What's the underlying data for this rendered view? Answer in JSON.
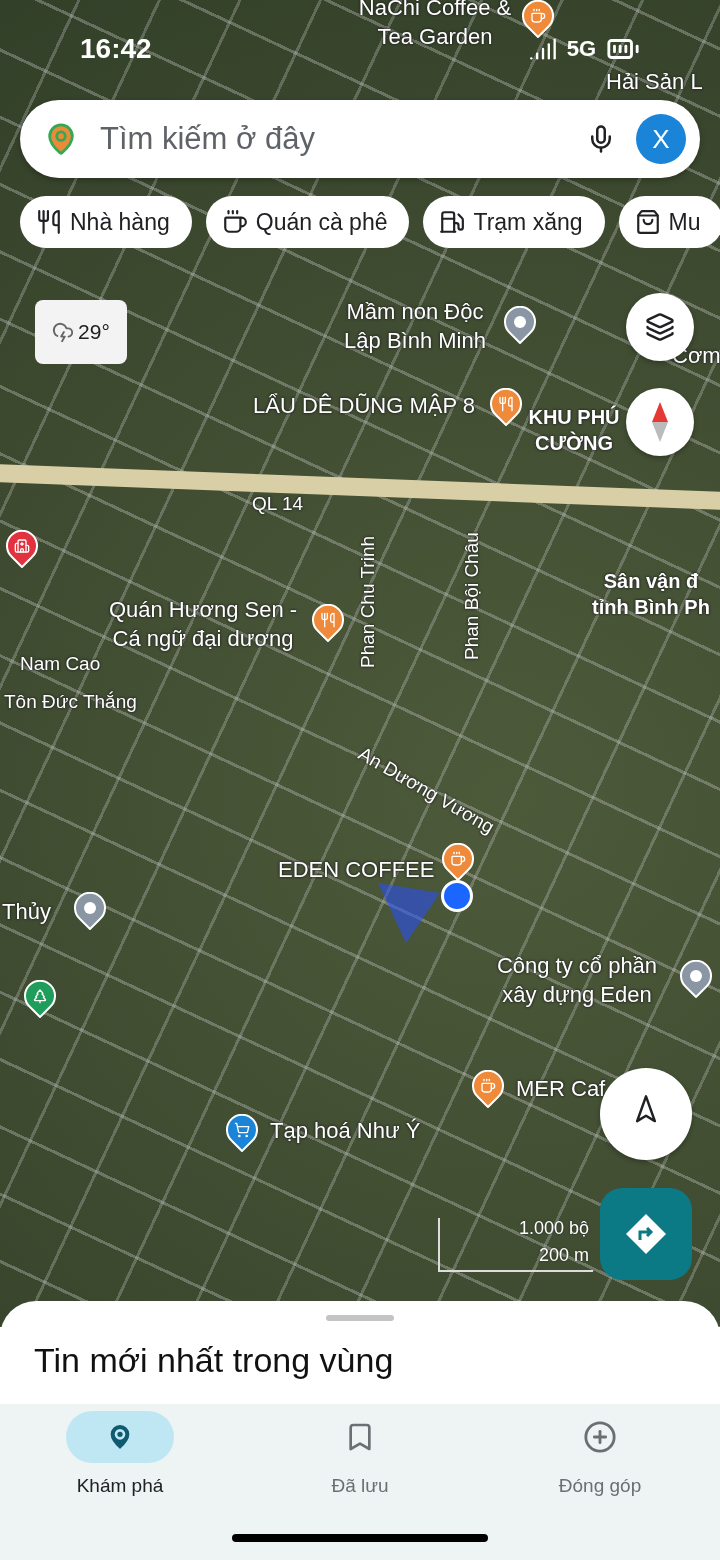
{
  "status_bar": {
    "time": "16:42",
    "network": "5G"
  },
  "search": {
    "placeholder": "Tìm kiếm ở đây",
    "avatar": "X"
  },
  "chips": [
    {
      "label": "Nhà hàng",
      "kind": "food"
    },
    {
      "label": "Quán cà phê",
      "kind": "coffee"
    },
    {
      "label": "Trạm xăng",
      "kind": "fuel"
    },
    {
      "label": "Mu",
      "kind": "shop"
    }
  ],
  "weather": {
    "temperature": "29°"
  },
  "map_labels": [
    {
      "text": "NaChi Coffee & Tea Garden",
      "kind": "place"
    },
    {
      "text": "Hải Sản L",
      "kind": "place"
    },
    {
      "text": "Mầm non Độc Lập Bình Minh",
      "kind": "place"
    },
    {
      "text": "Cơm",
      "kind": "place"
    },
    {
      "text": "LẨU DÊ DŨNG MẬP 8",
      "kind": "place"
    },
    {
      "text": "KHU PHÚ CƯỜNG",
      "kind": "area"
    },
    {
      "text": "QL 14",
      "kind": "road"
    },
    {
      "text": "Quán Hương Sen - Cá ngữ đại dương",
      "kind": "place"
    },
    {
      "text": "Sân vận đ tỉnh Bình Ph",
      "kind": "area"
    },
    {
      "text": "Phan Chu Trinh",
      "kind": "road"
    },
    {
      "text": "Phan Bội Châu",
      "kind": "road"
    },
    {
      "text": "Nam Cao",
      "kind": "road"
    },
    {
      "text": "Tôn Đức Thắng",
      "kind": "road"
    },
    {
      "text": "An Dương Vương",
      "kind": "road"
    },
    {
      "text": "EDEN COFFEE",
      "kind": "place"
    },
    {
      "text": "Thủy",
      "kind": "place"
    },
    {
      "text": "Công ty cổ phần xây dựng Eden",
      "kind": "place"
    },
    {
      "text": "MER Caf",
      "kind": "place"
    },
    {
      "text": "Tạp hoá Như Ý",
      "kind": "place"
    }
  ],
  "map_pins": [
    {
      "kind": "coffee"
    },
    {
      "kind": "generic"
    },
    {
      "kind": "food"
    },
    {
      "kind": "hospital"
    },
    {
      "kind": "food"
    },
    {
      "kind": "coffee"
    },
    {
      "kind": "generic"
    },
    {
      "kind": "park"
    },
    {
      "kind": "generic"
    },
    {
      "kind": "coffee"
    },
    {
      "kind": "shop"
    }
  ],
  "scale": {
    "imperial": "1.000 bộ",
    "metric": "200 m"
  },
  "sheet": {
    "title": "Tin mới nhất trong vùng"
  },
  "nav": [
    {
      "label": "Khám phá",
      "selected": true
    },
    {
      "label": "Đã lưu",
      "selected": false
    },
    {
      "label": "Đóng góp",
      "selected": false
    }
  ]
}
